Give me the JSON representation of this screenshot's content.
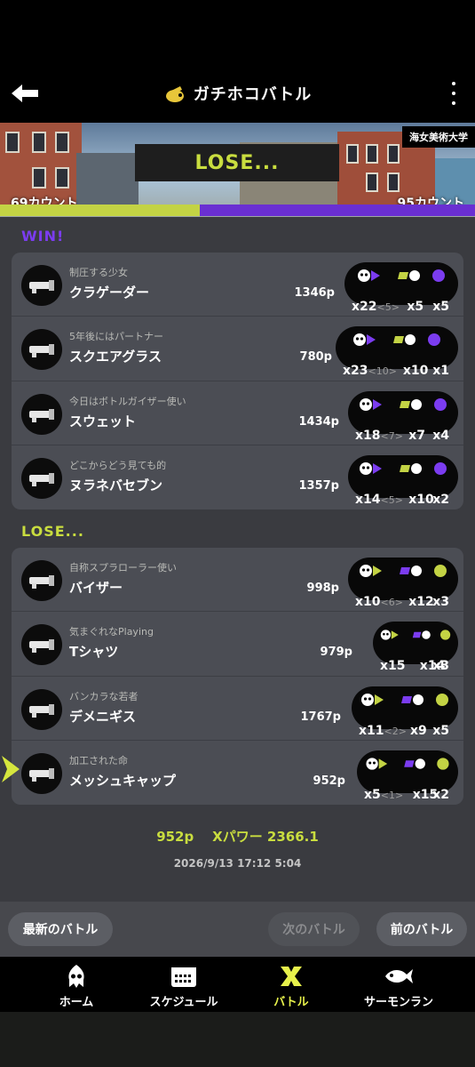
{
  "header": {
    "title": "ガチホコバトル"
  },
  "banner": {
    "stage": "海女美術大学",
    "result": "LOSE...",
    "score_left": "69カウント",
    "score_right": "95カウント"
  },
  "win_label": "WIN!",
  "lose_label": "LOSE...",
  "win_team": [
    {
      "byname": "制圧する少女",
      "name": "クラゲーダー",
      "power": "1346p",
      "kills": "x22",
      "assists": "<5>",
      "specials_k": "x5",
      "specials": "x5"
    },
    {
      "byname": "5年後にはパートナー",
      "name": "スクエアグラス",
      "power": "780p",
      "kills": "x23",
      "assists": "<10>",
      "specials_k": "x10",
      "specials": "x1"
    },
    {
      "byname": "今日はボトルガイザー使い",
      "name": "スウェット",
      "power": "1434p",
      "kills": "x18",
      "assists": "<7>",
      "specials_k": "x7",
      "specials": "x4"
    },
    {
      "byname": "どこからどう見ても的",
      "name": "ヌラネバセブン",
      "power": "1357p",
      "kills": "x14",
      "assists": "<5>",
      "specials_k": "x10",
      "specials": "x2"
    }
  ],
  "lose_team": [
    {
      "byname": "自称スプラローラー使い",
      "name": "バイザー",
      "power": "998p",
      "kills": "x10",
      "assists": "<6>",
      "specials_k": "x12",
      "specials": "x3"
    },
    {
      "byname": "気まぐれなPlaying",
      "name": "Tシャツ",
      "power": "979p",
      "kills": "x15",
      "assists": "",
      "specials_k": "x14",
      "specials": "x3"
    },
    {
      "byname": "バンカラな若者",
      "name": "デメニギス",
      "power": "1767p",
      "kills": "x11",
      "assists": "<2>",
      "specials_k": "x9",
      "specials": "x5"
    },
    {
      "byname": "加工された命",
      "name": "メッシュキャップ",
      "power": "952p",
      "kills": "x5",
      "assists": "<1>",
      "specials_k": "x15",
      "specials": "x2"
    }
  ],
  "summary": {
    "power": "952p",
    "xpower": "Xパワー 2366.1",
    "datetime": "2026/9/13 17:12 5:04"
  },
  "nav": {
    "latest": "最新のバトル",
    "next": "次のバトル",
    "prev": "前のバトル"
  },
  "tabs": [
    {
      "label": "ホーム",
      "icon": "squid-icon"
    },
    {
      "label": "スケジュール",
      "icon": "calendar-icon"
    },
    {
      "label": "バトル",
      "icon": "battle-icon"
    },
    {
      "label": "サーモンラン",
      "icon": "salmon-icon"
    }
  ],
  "colors": {
    "alpha_yellow": "#c3d344",
    "bravo_purple": "#6a2fd2",
    "accent_yellow": "#c9dd3f"
  }
}
